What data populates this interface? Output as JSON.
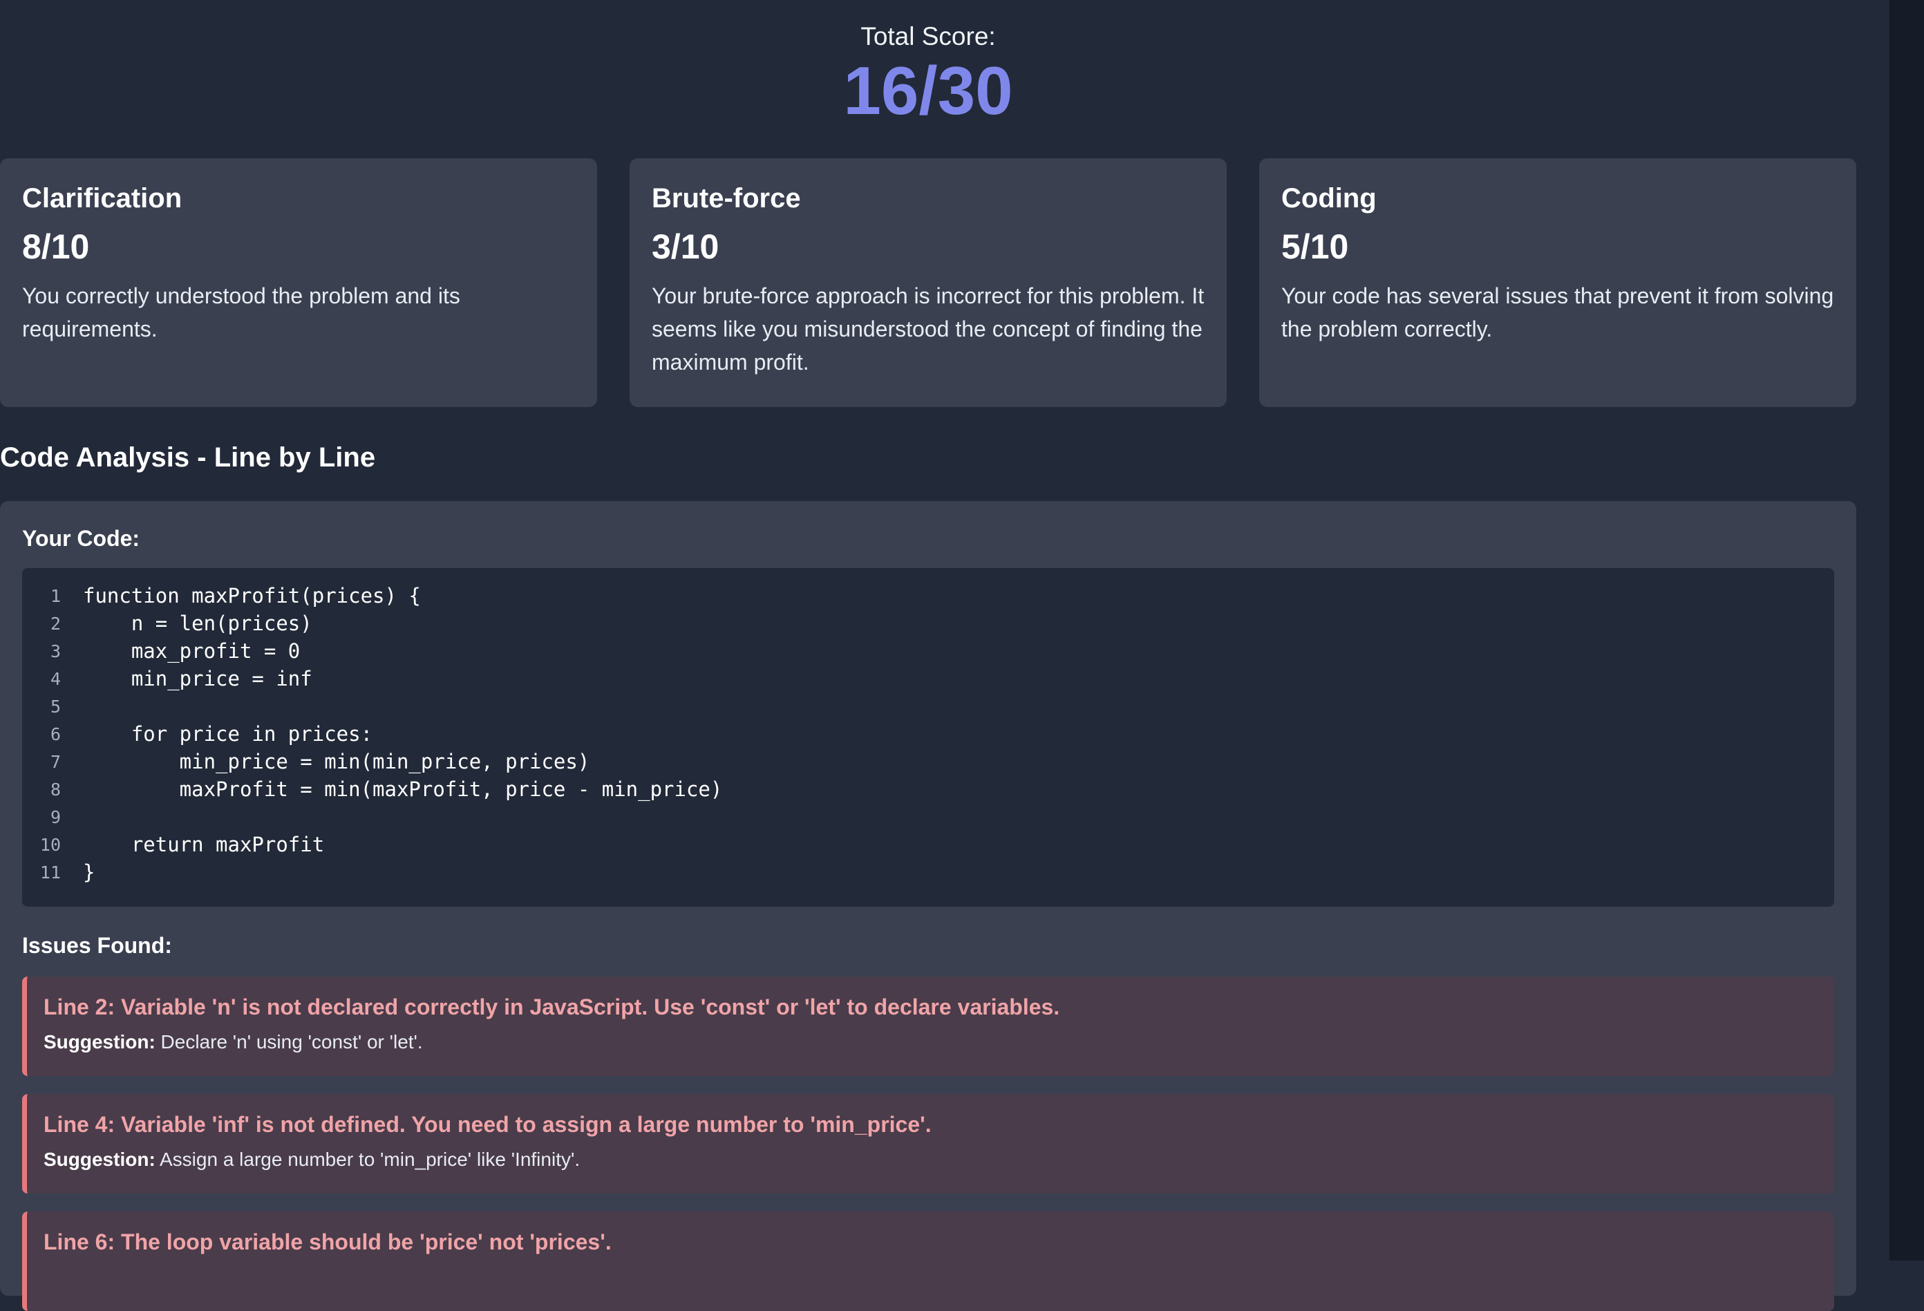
{
  "header": {
    "total_score_label": "Total Score:",
    "total_score_value": "16/30"
  },
  "cards": [
    {
      "title": "Clarification",
      "score": "8/10",
      "text": "You correctly understood the problem and its requirements."
    },
    {
      "title": "Brute-force",
      "score": "3/10",
      "text": "Your brute-force approach is incorrect for this problem. It seems like you misunderstood the concept of finding the maximum profit."
    },
    {
      "title": "Coding",
      "score": "5/10",
      "text": "Your code has several issues that prevent it from solving the problem correctly."
    }
  ],
  "analysis": {
    "title": "Code Analysis - Line by Line",
    "code_heading": "Your Code:",
    "code_lines": [
      {
        "num": "1",
        "text": "function maxProfit(prices) {"
      },
      {
        "num": "2",
        "text": "    n = len(prices)"
      },
      {
        "num": "3",
        "text": "    max_profit = 0"
      },
      {
        "num": "4",
        "text": "    min_price = inf"
      },
      {
        "num": "5",
        "text": ""
      },
      {
        "num": "6",
        "text": "    for price in prices:"
      },
      {
        "num": "7",
        "text": "        min_price = min(min_price, prices)"
      },
      {
        "num": "8",
        "text": "        maxProfit = min(maxProfit, price - min_price)"
      },
      {
        "num": "9",
        "text": ""
      },
      {
        "num": "10",
        "text": "    return maxProfit"
      },
      {
        "num": "11",
        "text": "}"
      }
    ],
    "issues_heading": "Issues Found:",
    "suggestion_label": "Suggestion:",
    "issues": [
      {
        "title": "Line 2: Variable 'n' is not declared correctly in JavaScript. Use 'const' or 'let' to declare variables.",
        "suggestion": "Declare 'n' using 'const' or 'let'."
      },
      {
        "title": "Line 4: Variable 'inf' is not defined. You need to assign a large number to 'min_price'.",
        "suggestion": "Assign a large number to 'min_price' like 'Infinity'."
      },
      {
        "title": "Line 6: The loop variable should be 'price' not 'prices'.",
        "suggestion": ""
      }
    ]
  },
  "colors": {
    "background": "#222938",
    "card": "#3a4050",
    "accent": "#7f88ea",
    "issue_border": "#e7787d",
    "issue_text": "#f0a4a8"
  }
}
